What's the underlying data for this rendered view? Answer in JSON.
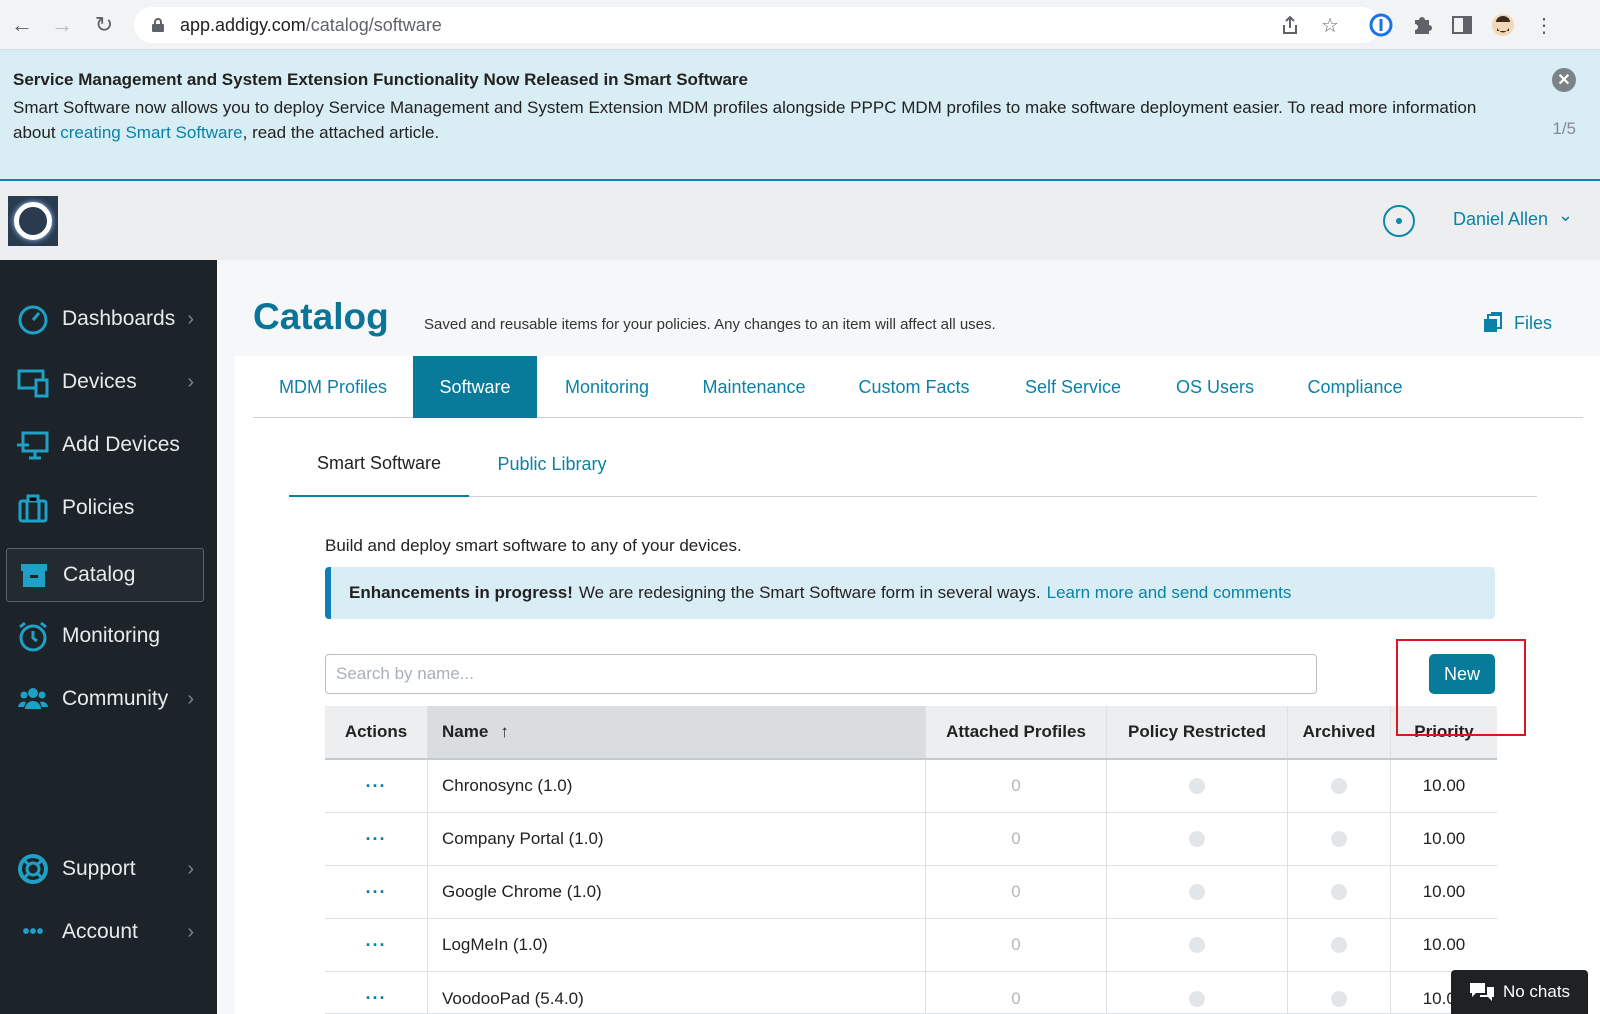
{
  "browser": {
    "url_host": "app.addigy.com",
    "url_path": "/catalog/software"
  },
  "banner": {
    "title": "Service Management and System Extension Functionality Now Released in Smart Software",
    "text_before": "Smart Software now allows you to deploy Service Management and System Extension MDM profiles alongside PPPC MDM profiles to make software deployment easier. To read more information about ",
    "link": "creating Smart Software",
    "text_after": ", read the attached article.",
    "page": "1/5"
  },
  "header": {
    "user_name": "Daniel Allen"
  },
  "sidebar": {
    "items": [
      {
        "label": "Dashboards",
        "icon": "gauge-icon",
        "chevron": true
      },
      {
        "label": "Devices",
        "icon": "devices-icon",
        "chevron": true
      },
      {
        "label": "Add Devices",
        "icon": "add-device-icon",
        "chevron": false
      },
      {
        "label": "Policies",
        "icon": "briefcase-icon",
        "chevron": false
      },
      {
        "label": "Catalog",
        "icon": "archive-box-icon",
        "chevron": false,
        "active": true
      },
      {
        "label": "Monitoring",
        "icon": "alarm-clock-icon",
        "chevron": false
      },
      {
        "label": "Community",
        "icon": "users-icon",
        "chevron": true
      },
      {
        "label": "Support",
        "icon": "lifebuoy-icon",
        "chevron": true
      },
      {
        "label": "Account",
        "icon": "ellipsis-icon",
        "chevron": true
      }
    ]
  },
  "page": {
    "title": "Catalog",
    "subtitle": "Saved and reusable items for your policies. Any changes to an item will affect all uses.",
    "files_label": "Files"
  },
  "tabs": [
    "MDM Profiles",
    "Software",
    "Monitoring",
    "Maintenance",
    "Custom Facts",
    "Self Service",
    "OS Users",
    "Compliance"
  ],
  "active_tab": "Software",
  "subtabs": [
    "Smart Software",
    "Public Library"
  ],
  "active_subtab": "Smart Software",
  "content": {
    "intro": "Build and deploy smart software to any of your devices.",
    "alert_bold": "Enhancements in progress!",
    "alert_text": "We are redesigning the Smart Software form in several ways.",
    "alert_link": "Learn more and send comments",
    "search_placeholder": "Search by name...",
    "new_button": "New"
  },
  "table": {
    "columns": [
      "Actions",
      "Name",
      "Attached Profiles",
      "Policy Restricted",
      "Archived",
      "Priority"
    ],
    "sort_indicator": "↑",
    "action_glyph": "···",
    "rows": [
      {
        "name": "Chronosync (1.0)",
        "attached": "0",
        "priority": "10.00"
      },
      {
        "name": "Company Portal (1.0)",
        "attached": "0",
        "priority": "10.00"
      },
      {
        "name": "Google Chrome (1.0)",
        "attached": "0",
        "priority": "10.00"
      },
      {
        "name": "LogMeIn (1.0)",
        "attached": "0",
        "priority": "10.00"
      },
      {
        "name": "VoodooPad (5.4.0)",
        "attached": "0",
        "priority": "10.00"
      }
    ]
  },
  "chat": {
    "label": "No chats"
  },
  "colors": {
    "accent": "#087b9b",
    "link": "#0a82a6",
    "sidebar_bg": "#1c2329",
    "highlight": "#e0141f"
  }
}
